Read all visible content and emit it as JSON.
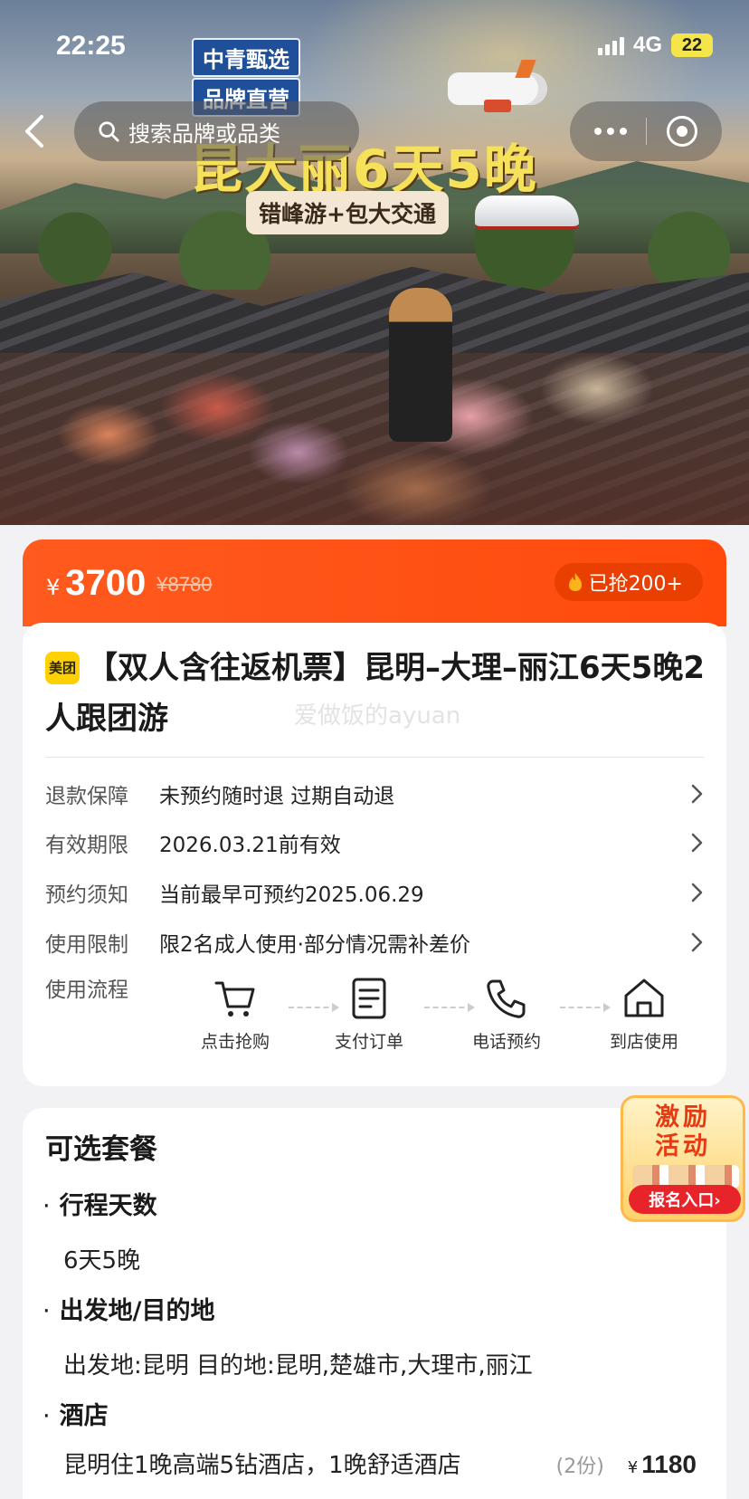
{
  "status_bar": {
    "time": "22:25",
    "network": "4G",
    "battery": "22"
  },
  "nav": {
    "search_placeholder": "搜索品牌或品类"
  },
  "hero": {
    "badge_top": "中青甄选",
    "badge_bottom": "品牌直营",
    "title": "昆大丽6天5晚",
    "subtitle": "错峰游+包大交通"
  },
  "price_bar": {
    "currency": "¥",
    "price": "3700",
    "original_price": "¥8780",
    "sold": "已抢200+"
  },
  "product": {
    "brand_logo": "美团",
    "title": "【双人含往返机票】昆明–大理–丽江6天5晚2人跟团游",
    "watermark": "爱做饭的ayuan"
  },
  "info_rows": [
    {
      "label": "退款保障",
      "value": "未预约随时退 过期自动退"
    },
    {
      "label": "有效期限",
      "value": "2026.03.21前有效"
    },
    {
      "label": "预约须知",
      "value": "当前最早可预约2025.06.29"
    },
    {
      "label": "使用限制",
      "value": "限2名成人使用·部分情况需补差价"
    }
  ],
  "usage_flow": {
    "label": "使用流程",
    "steps": [
      {
        "label": "点击抢购",
        "icon": "cart-icon"
      },
      {
        "label": "支付订单",
        "icon": "document-icon"
      },
      {
        "label": "电话预约",
        "icon": "phone-icon"
      },
      {
        "label": "到店使用",
        "icon": "store-icon"
      }
    ]
  },
  "options": {
    "title": "可选套餐",
    "items": [
      {
        "head": "行程天数",
        "value": "6天5晚"
      },
      {
        "head": "出发地/目的地",
        "value": "出发地:昆明 目的地:昆明,楚雄市,大理市,丽江"
      },
      {
        "head": "酒店"
      }
    ],
    "hotel": {
      "name": "昆明住1晚高端5钻酒店，1晚舒适酒店",
      "qty": "(2份)",
      "currency": "¥",
      "amount": "1180"
    }
  },
  "promo": {
    "line1": "激励",
    "line2": "活动",
    "cta": "报名入口›"
  },
  "colors": {
    "accent": "#ff5a1f",
    "sold_badge": "#e93f00",
    "brand_yellow": "#ffd100"
  }
}
